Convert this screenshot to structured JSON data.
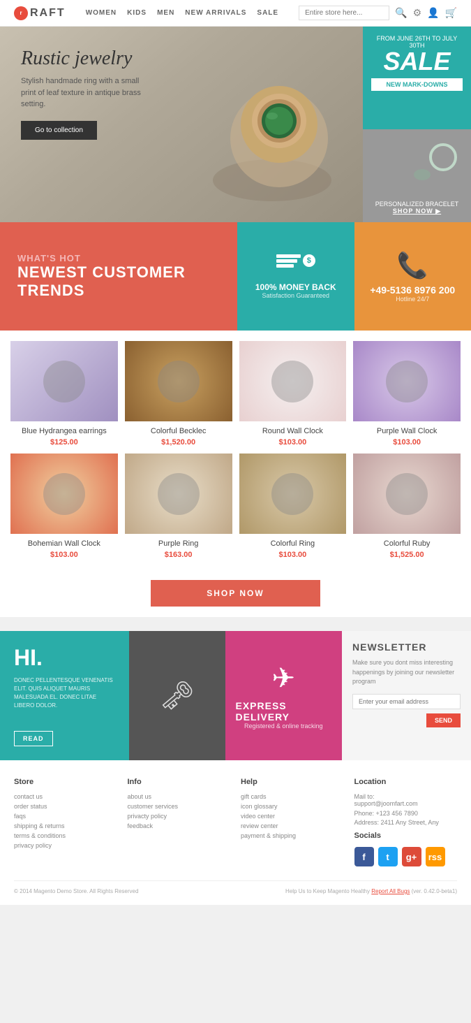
{
  "header": {
    "logo": "raft",
    "nav": [
      "WOMEN",
      "KIDS",
      "MEN",
      "NEW ARRIVALS",
      "SALE"
    ],
    "search_placeholder": "Entire store here..."
  },
  "hero": {
    "title": "Rustic jewelry",
    "subtitle": "Stylish handmade ring with a small print of leaf texture in antique brass setting.",
    "cta": "Go to collection",
    "sale_from": "FROM JUNE 26TH TO JULY 30TH",
    "sale_text": "SALE",
    "sale_sub": "NEW MARK-DOWNS",
    "bracelet_text": "PERSONALIZED BRACELET",
    "bracelet_cta": "SHOP NOW ▶"
  },
  "banner": {
    "hot_sub": "WHAT'S HOT",
    "hot_title": "NEWEST CUSTOMER TRENDS",
    "money_title": "100% MONEY BACK",
    "money_sub": "Satisfaction Guaranteed",
    "phone_number": "+49-5136 8976 200",
    "phone_sub": "Hotline 24/7"
  },
  "products": [
    {
      "name": "Blue Hydrangea earrings",
      "price": "$125.00",
      "img_class": "img-earrings"
    },
    {
      "name": "Colorful Becklec",
      "price": "$1,520.00",
      "img_class": "img-becklec"
    },
    {
      "name": "Round Wall Clock",
      "price": "$103.00",
      "img_class": "img-clock-round"
    },
    {
      "name": "Purple Wall Clock",
      "price": "$103.00",
      "img_class": "img-clock-purple"
    },
    {
      "name": "Bohemian Wall Clock",
      "price": "$103.00",
      "img_class": "img-clock-bohemian"
    },
    {
      "name": "Purple Ring",
      "price": "$163.00",
      "img_class": "img-ring-purple"
    },
    {
      "name": "Colorful Ring",
      "price": "$103.00",
      "img_class": "img-ring-colorful"
    },
    {
      "name": "Colorful Ruby",
      "price": "$1,525.00",
      "img_class": "img-ruby"
    }
  ],
  "shop_btn": "SHOP NOW",
  "promo": {
    "hi_title": "HI.",
    "hi_text": "DONEC PELLENTESQUE VENENATIS ELIT. QUIS ALIQUET MAURIS MALESUADA EL. DONEC LITAE LIBERO DOLOR.",
    "hi_btn": "READ",
    "delivery_title": "EXPRESS DELIVERY",
    "delivery_sub": "Registered & online tracking"
  },
  "newsletter": {
    "title": "NEWSLETTER",
    "text": "Make sure you dont miss interesting happenings by joining our newsletter program",
    "placeholder": "Enter your email address",
    "btn": "SEND"
  },
  "footer": {
    "store": {
      "title": "Store",
      "links": [
        "contact us",
        "order status",
        "faqs",
        "shipping & returns",
        "terms & conditions",
        "privacy policy"
      ]
    },
    "info": {
      "title": "Info",
      "links": [
        "about us",
        "customer services",
        "privacty policy",
        "feedback"
      ]
    },
    "help": {
      "title": "Help",
      "links": [
        "gift cards",
        "icon glossary",
        "video center",
        "review center",
        "payment & shipping"
      ]
    },
    "location": {
      "title": "Location",
      "email": "support@joomfart.com",
      "phone": "Phone: +123 456 7890",
      "address": "Address: 2411 Any Street, Any",
      "socials_title": "Socials"
    },
    "copyright": "© 2014 Magento Demo Store. All Rights Reserved",
    "help_text": "Help Us to Keep Magento Healthy",
    "report": "Report All Bugs",
    "version": "(ver. 0.42.0-beta1)"
  }
}
